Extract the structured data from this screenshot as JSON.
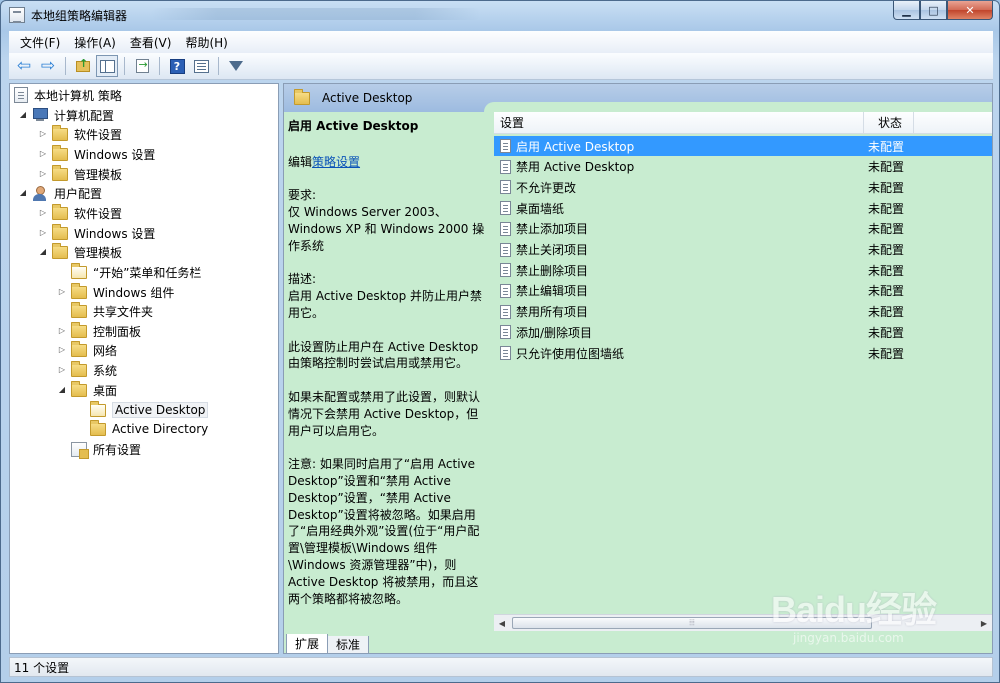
{
  "window": {
    "title": "本地组策略编辑器"
  },
  "menu": [
    "文件(F)",
    "操作(A)",
    "查看(V)",
    "帮助(H)"
  ],
  "toolbar": {
    "icons": [
      "back-arrow-icon",
      "forward-arrow-icon",
      "up-folder-icon",
      "show-hide-tree-icon",
      "export-list-icon",
      "help-icon",
      "view-icon",
      "filter-icon"
    ]
  },
  "tree": {
    "root": "本地计算机 策略",
    "computer_config": "计算机配置",
    "user_config": "用户配置",
    "computer_children": [
      "软件设置",
      "Windows 设置",
      "管理模板"
    ],
    "user_children": [
      "软件设置",
      "Windows 设置",
      "管理模板"
    ],
    "admin_templates": [
      "“开始”菜单和任务栏",
      "Windows 组件",
      "共享文件夹",
      "控制面板",
      "网络",
      "系统",
      "桌面"
    ],
    "desktop_children": [
      "Active Desktop",
      "Active Directory"
    ],
    "all_settings": "所有设置"
  },
  "right": {
    "header": "Active Desktop",
    "desc": {
      "title": "启用 Active Desktop",
      "edit_prefix": "编辑",
      "edit_link": "策略设置",
      "req_label": "要求:",
      "req_text": "仅 Windows Server 2003、Windows XP 和 Windows 2000 操作系统",
      "desc_label": "描述:",
      "desc_text": "启用 Active Desktop 并防止用户禁用它。",
      "p1": "此设置防止用户在 Active Desktop 由策略控制时尝试启用或禁用它。",
      "p2": "如果未配置或禁用了此设置，则默认情况下会禁用 Active Desktop，但用户可以启用它。",
      "p3": "注意: 如果同时启用了“启用 Active Desktop”设置和“禁用 Active Desktop”设置，“禁用 Active Desktop”设置将被忽略。如果启用了“启用经典外观”设置(位于“用户配置\\管理模板\\Windows 组件\\Windows 资源管理器”中)，则 Active Desktop 将被禁用，而且这两个策略都将被忽略。"
    },
    "columns": [
      "设置",
      "状态"
    ],
    "rows": [
      {
        "name": "启用 Active Desktop",
        "state": "未配置"
      },
      {
        "name": "禁用 Active Desktop",
        "state": "未配置"
      },
      {
        "name": "不允许更改",
        "state": "未配置"
      },
      {
        "name": "桌面墙纸",
        "state": "未配置"
      },
      {
        "name": "禁止添加项目",
        "state": "未配置"
      },
      {
        "name": "禁止关闭项目",
        "state": "未配置"
      },
      {
        "name": "禁止删除项目",
        "state": "未配置"
      },
      {
        "name": "禁止编辑项目",
        "state": "未配置"
      },
      {
        "name": "禁用所有项目",
        "state": "未配置"
      },
      {
        "name": "添加/删除项目",
        "state": "未配置"
      },
      {
        "name": "只允许使用位图墙纸",
        "state": "未配置"
      }
    ],
    "tabs": [
      "扩展",
      "标准"
    ]
  },
  "status": "11 个设置",
  "watermark": {
    "logo": "Baidu经验",
    "url": "jingyan.baidu.com"
  },
  "colors": {
    "selection": "#3399ff",
    "panel_bg": "#c8ecd0",
    "link": "#0a53b8"
  }
}
